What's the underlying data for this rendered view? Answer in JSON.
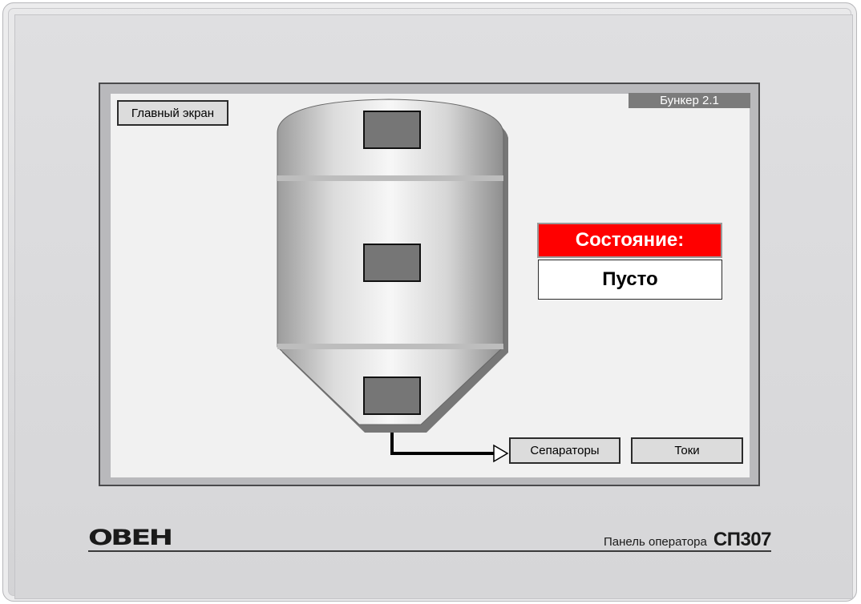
{
  "screen": {
    "title": "Бункер 2.1",
    "main_screen_button": "Главный экран",
    "status": {
      "label": "Состояние:",
      "value": "Пусто"
    },
    "nav_buttons": {
      "separators": "Сепараторы",
      "currents": "Токи"
    }
  },
  "panel": {
    "brand": "ОВЕН",
    "caption": "Панель оператора",
    "model": "СП307"
  },
  "colors": {
    "status_label_bg": "#ff0000",
    "title_tag_bg": "#7b7b7b",
    "screen_bg": "#f1f1f1"
  }
}
